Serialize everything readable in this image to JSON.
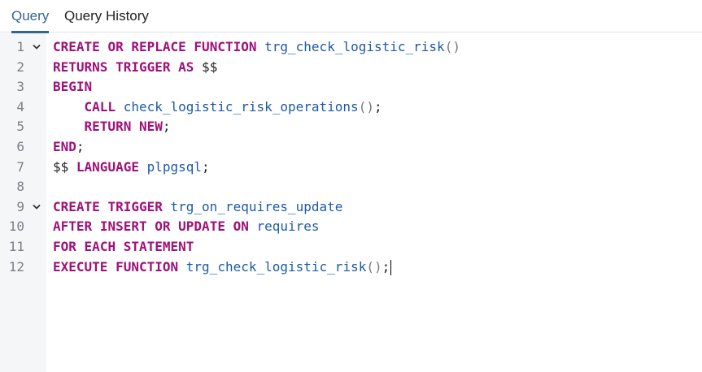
{
  "tabs": [
    {
      "label": "Query",
      "active": true
    },
    {
      "label": "Query History",
      "active": false
    }
  ],
  "colors": {
    "accent": "#326690",
    "keyword": "#a0107a",
    "identifier": "#1d5aa8",
    "line_number": "#7a7f86",
    "gutter_bg": "#f5f6f8"
  },
  "editor": {
    "lines": [
      {
        "number": "1",
        "fold": "chevron-down-icon",
        "tokens": [
          {
            "t": "CREATE",
            "c": "kw"
          },
          {
            "t": " ",
            "c": "pn"
          },
          {
            "t": "OR",
            "c": "kw"
          },
          {
            "t": " ",
            "c": "pn"
          },
          {
            "t": "REPLACE",
            "c": "kw"
          },
          {
            "t": " ",
            "c": "pn"
          },
          {
            "t": "FUNCTION",
            "c": "kw"
          },
          {
            "t": " ",
            "c": "pn"
          },
          {
            "t": "trg_check_logistic_risk",
            "c": "id"
          },
          {
            "t": "()",
            "c": "pa"
          }
        ]
      },
      {
        "number": "2",
        "fold": "",
        "tokens": [
          {
            "t": "RETURNS",
            "c": "kw"
          },
          {
            "t": " ",
            "c": "pn"
          },
          {
            "t": "TRIGGER",
            "c": "kw"
          },
          {
            "t": " ",
            "c": "pn"
          },
          {
            "t": "AS",
            "c": "kw"
          },
          {
            "t": " $$",
            "c": "pn"
          }
        ]
      },
      {
        "number": "3",
        "fold": "",
        "tokens": [
          {
            "t": "BEGIN",
            "c": "kw"
          }
        ]
      },
      {
        "number": "4",
        "fold": "",
        "tokens": [
          {
            "t": "    ",
            "c": "pn"
          },
          {
            "t": "CALL",
            "c": "kw"
          },
          {
            "t": " ",
            "c": "pn"
          },
          {
            "t": "check_logistic_risk_operations",
            "c": "id"
          },
          {
            "t": "()",
            "c": "pa"
          },
          {
            "t": ";",
            "c": "pn"
          }
        ]
      },
      {
        "number": "5",
        "fold": "",
        "tokens": [
          {
            "t": "    ",
            "c": "pn"
          },
          {
            "t": "RETURN",
            "c": "kw"
          },
          {
            "t": " ",
            "c": "pn"
          },
          {
            "t": "NEW",
            "c": "kw"
          },
          {
            "t": ";",
            "c": "pn"
          }
        ]
      },
      {
        "number": "6",
        "fold": "",
        "tokens": [
          {
            "t": "END",
            "c": "kw"
          },
          {
            "t": ";",
            "c": "pn"
          }
        ]
      },
      {
        "number": "7",
        "fold": "",
        "tokens": [
          {
            "t": "$$ ",
            "c": "pn"
          },
          {
            "t": "LANGUAGE",
            "c": "kw"
          },
          {
            "t": " ",
            "c": "pn"
          },
          {
            "t": "plpgsql",
            "c": "id"
          },
          {
            "t": ";",
            "c": "pn"
          }
        ]
      },
      {
        "number": "8",
        "fold": "",
        "tokens": []
      },
      {
        "number": "9",
        "fold": "chevron-down-icon",
        "tokens": [
          {
            "t": "CREATE",
            "c": "kw"
          },
          {
            "t": " ",
            "c": "pn"
          },
          {
            "t": "TRIGGER",
            "c": "kw"
          },
          {
            "t": " ",
            "c": "pn"
          },
          {
            "t": "trg_on_requires_update",
            "c": "id"
          }
        ]
      },
      {
        "number": "10",
        "fold": "",
        "tokens": [
          {
            "t": "AFTER",
            "c": "kw"
          },
          {
            "t": " ",
            "c": "pn"
          },
          {
            "t": "INSERT",
            "c": "kw"
          },
          {
            "t": " ",
            "c": "pn"
          },
          {
            "t": "OR",
            "c": "kw"
          },
          {
            "t": " ",
            "c": "pn"
          },
          {
            "t": "UPDATE",
            "c": "kw"
          },
          {
            "t": " ",
            "c": "pn"
          },
          {
            "t": "ON",
            "c": "kw"
          },
          {
            "t": " ",
            "c": "pn"
          },
          {
            "t": "requires",
            "c": "id"
          }
        ]
      },
      {
        "number": "11",
        "fold": "",
        "tokens": [
          {
            "t": "FOR",
            "c": "kw"
          },
          {
            "t": " ",
            "c": "pn"
          },
          {
            "t": "EACH",
            "c": "kw"
          },
          {
            "t": " ",
            "c": "pn"
          },
          {
            "t": "STATEMENT",
            "c": "kw"
          }
        ]
      },
      {
        "number": "12",
        "fold": "",
        "cursor": true,
        "tokens": [
          {
            "t": "EXECUTE",
            "c": "kw"
          },
          {
            "t": " ",
            "c": "pn"
          },
          {
            "t": "FUNCTION",
            "c": "kw"
          },
          {
            "t": " ",
            "c": "pn"
          },
          {
            "t": "trg_check_logistic_risk",
            "c": "id"
          },
          {
            "t": "()",
            "c": "pa"
          },
          {
            "t": ";",
            "c": "pn"
          }
        ]
      }
    ]
  }
}
